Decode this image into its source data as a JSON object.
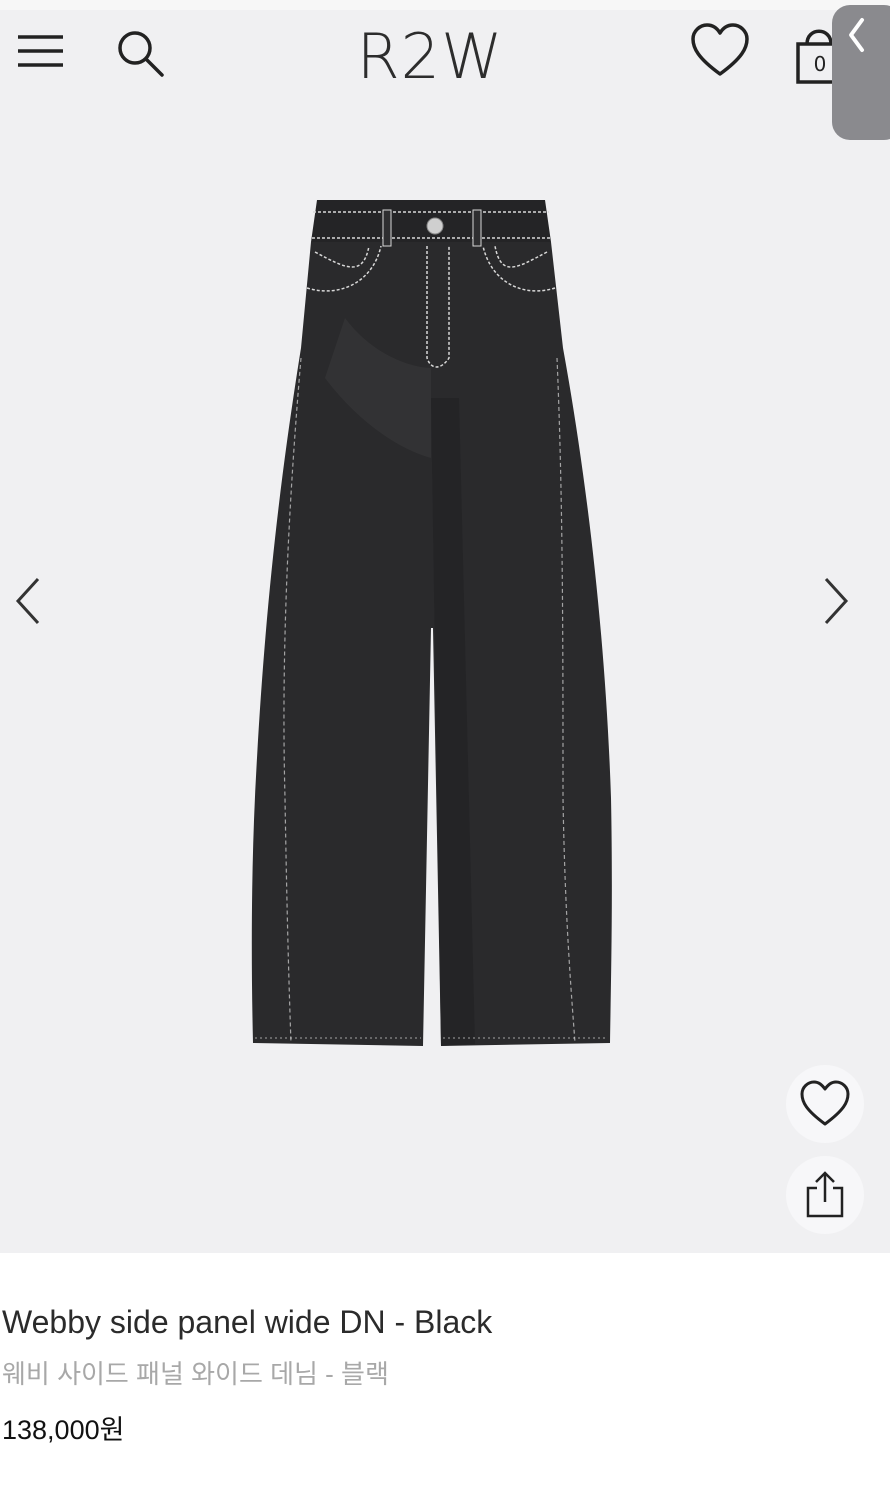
{
  "header": {
    "logo": "R2W",
    "cart_count": "0",
    "icons": [
      "menu-icon",
      "search-icon",
      "heart-icon",
      "shopping-bag-icon"
    ]
  },
  "gallery": {
    "image_alt": "black wide denim jeans",
    "prev_icon": "chevron-left-icon",
    "next_icon": "chevron-right-icon",
    "actions": [
      "heart-icon",
      "share-icon"
    ]
  },
  "product": {
    "title": "Webby side panel wide DN - Black",
    "subtitle": "웨비 사이드 패널 와이드 데님 - 블랙",
    "price": "138,000원"
  },
  "colors": {
    "gallery_bg": "#f0f0f2",
    "denim": "#2a2a2c",
    "stitch": "#d8d8d8",
    "side_tab": "#8a8a8e"
  }
}
